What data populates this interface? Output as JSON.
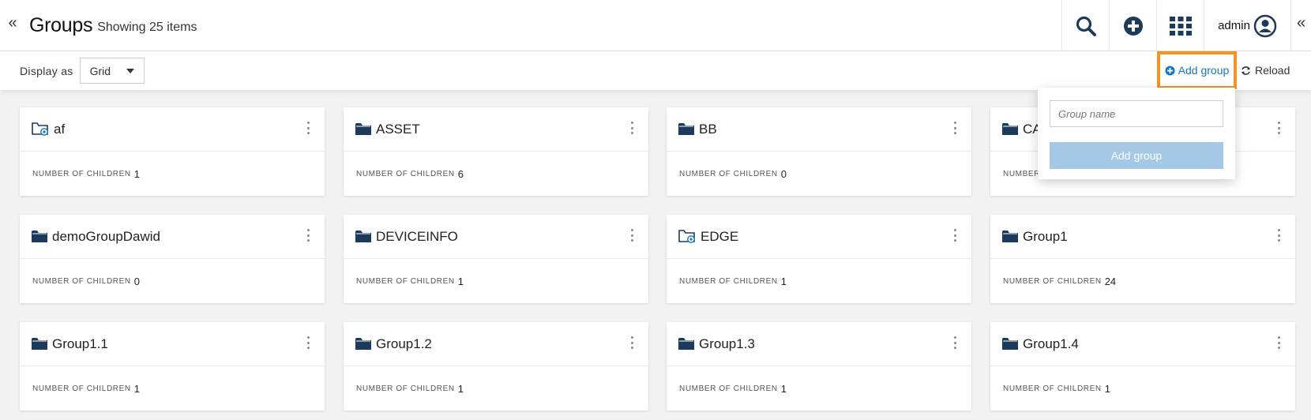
{
  "header": {
    "title": "Groups",
    "subtitle": "Showing 25 items",
    "collapse_left": "«",
    "collapse_right": "«",
    "user_name": "admin",
    "icons": [
      "search-icon",
      "plus-circle-icon",
      "apps-grid-icon",
      "user-avatar-icon"
    ]
  },
  "toolbar": {
    "display_label": "Display as",
    "display_value": "Grid",
    "add_group_label": "Add group",
    "reload_label": "Reload"
  },
  "popover": {
    "placeholder": "Group name",
    "button_label": "Add group",
    "button_color": "#a5c8e7"
  },
  "colors": {
    "accent": "#1776bf",
    "highlight": "#f7931e",
    "folder": "#1b3a5c"
  },
  "meta_label": "NUMBER OF CHILDREN",
  "groups": [
    {
      "name": "af",
      "children": "1",
      "icon": "smart-folder-icon"
    },
    {
      "name": "ASSET",
      "children": "6",
      "icon": "folder-icon"
    },
    {
      "name": "BB",
      "children": "0",
      "icon": "folder-icon"
    },
    {
      "name": "CA",
      "children": "",
      "icon": "folder-icon"
    },
    {
      "name": "demoGroupDawid",
      "children": "0",
      "icon": "folder-icon"
    },
    {
      "name": "DEVICEINFO",
      "children": "1",
      "icon": "folder-icon"
    },
    {
      "name": "EDGE",
      "children": "1",
      "icon": "smart-folder-icon"
    },
    {
      "name": "Group1",
      "children": "24",
      "icon": "folder-icon"
    },
    {
      "name": "Group1.1",
      "children": "1",
      "icon": "folder-icon"
    },
    {
      "name": "Group1.2",
      "children": "1",
      "icon": "folder-icon"
    },
    {
      "name": "Group1.3",
      "children": "1",
      "icon": "folder-icon"
    },
    {
      "name": "Group1.4",
      "children": "1",
      "icon": "folder-icon"
    }
  ]
}
